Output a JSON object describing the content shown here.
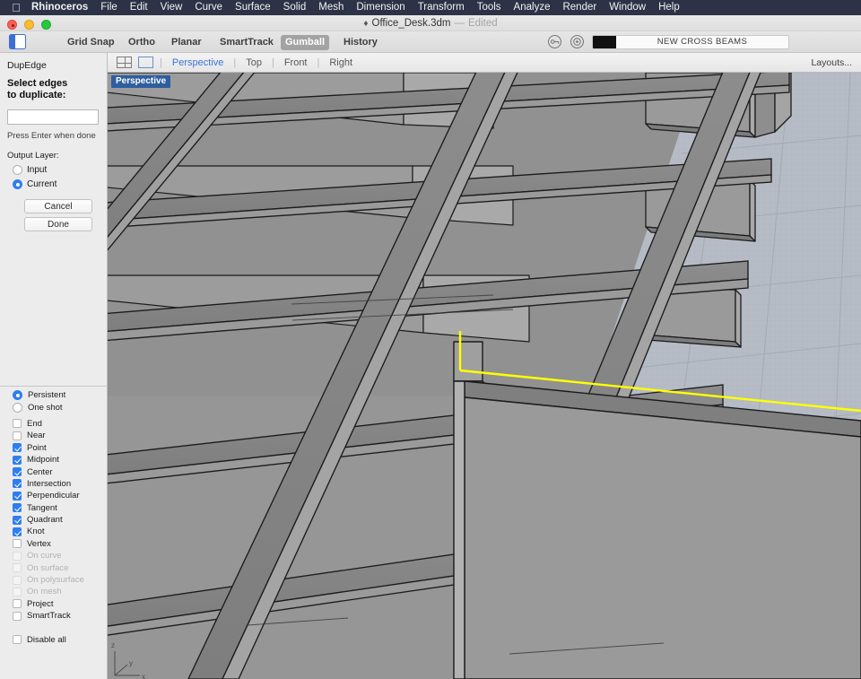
{
  "menubar": {
    "apple_icon": "apple-logo-icon",
    "items": [
      {
        "label": "Rhinoceros",
        "bold": true
      },
      {
        "label": "File"
      },
      {
        "label": "Edit"
      },
      {
        "label": "View"
      },
      {
        "label": "Curve"
      },
      {
        "label": "Surface"
      },
      {
        "label": "Solid"
      },
      {
        "label": "Mesh"
      },
      {
        "label": "Dimension"
      },
      {
        "label": "Transform"
      },
      {
        "label": "Tools"
      },
      {
        "label": "Analyze"
      },
      {
        "label": "Render"
      },
      {
        "label": "Window"
      },
      {
        "label": "Help"
      }
    ]
  },
  "titlebar": {
    "document": "Office_Desk.3dm",
    "separator": "—",
    "status": "Edited",
    "doc_icon": "rhino-document-icon"
  },
  "toolbar": {
    "sidebar_toggle_icon": "sidebar-toggle-icon",
    "buttons": [
      {
        "label": "Grid Snap",
        "active": false
      },
      {
        "label": "Ortho",
        "active": false
      },
      {
        "label": "Planar",
        "active": false
      },
      {
        "label": "SmartTrack",
        "active": false
      },
      {
        "label": "Gumball",
        "active": true
      },
      {
        "label": "History",
        "active": false
      }
    ],
    "lock_icon": "layer-lock-icon",
    "visibility_icon": "layer-visibility-icon",
    "layer_color": "#111111",
    "layer_name": "NEW CROSS BEAMS"
  },
  "command_panel": {
    "command_name": "DupEdge",
    "prompt_line1": "Select edges",
    "prompt_line2": "to duplicate:",
    "input_value": "",
    "input_placeholder": "",
    "hint": "Press Enter when done",
    "output_layer_label": "Output Layer:",
    "output_layer_options": [
      {
        "label": "Input",
        "selected": false
      },
      {
        "label": "Current",
        "selected": true
      }
    ],
    "cancel_label": "Cancel",
    "done_label": "Done"
  },
  "osnap_panel": {
    "modes": [
      {
        "label": "Persistent",
        "selected": true
      },
      {
        "label": "One shot",
        "selected": false
      }
    ],
    "snaps": [
      {
        "label": "End",
        "checked": false,
        "disabled": false
      },
      {
        "label": "Near",
        "checked": false,
        "disabled": false
      },
      {
        "label": "Point",
        "checked": true,
        "disabled": false
      },
      {
        "label": "Midpoint",
        "checked": true,
        "disabled": false
      },
      {
        "label": "Center",
        "checked": true,
        "disabled": false
      },
      {
        "label": "Intersection",
        "checked": true,
        "disabled": false
      },
      {
        "label": "Perpendicular",
        "checked": true,
        "disabled": false
      },
      {
        "label": "Tangent",
        "checked": true,
        "disabled": false
      },
      {
        "label": "Quadrant",
        "checked": true,
        "disabled": false
      },
      {
        "label": "Knot",
        "checked": true,
        "disabled": false
      },
      {
        "label": "Vertex",
        "checked": false,
        "disabled": false
      },
      {
        "label": "On curve",
        "checked": false,
        "disabled": true
      },
      {
        "label": "On surface",
        "checked": false,
        "disabled": true
      },
      {
        "label": "On polysurface",
        "checked": false,
        "disabled": true
      },
      {
        "label": "On mesh",
        "checked": false,
        "disabled": true
      },
      {
        "label": "Project",
        "checked": false,
        "disabled": false
      },
      {
        "label": "SmartTrack",
        "checked": false,
        "disabled": false
      }
    ],
    "disable_all": {
      "label": "Disable all",
      "checked": false
    }
  },
  "viewtabs": {
    "quad_icon": "four-view-layout-icon",
    "single_icon": "single-view-layout-icon",
    "divider": "|",
    "tabs": [
      {
        "label": "Perspective",
        "active": true
      },
      {
        "label": "Top",
        "active": false
      },
      {
        "label": "Front",
        "active": false
      },
      {
        "label": "Right",
        "active": false
      }
    ],
    "layouts_label": "Layouts..."
  },
  "viewport": {
    "label": "Perspective",
    "display_mode": "shaded",
    "axis_labels": {
      "x": "x",
      "y": "y",
      "z": "z"
    },
    "colors": {
      "background": "#919191",
      "surface_top": "#999999",
      "surface_side_light": "#b0b0b0",
      "surface_side_dark": "#888888",
      "beam_face": "#8a8a8a",
      "edge": "#1b1b1b",
      "ground_plane": "#b6bcc6",
      "grid_line": "#a8aeb8",
      "selected_edge": "#ffff00"
    },
    "selection": {
      "type": "edge",
      "color": "#ffff00",
      "description": "duplicated edge highlighted on desk panel"
    }
  }
}
